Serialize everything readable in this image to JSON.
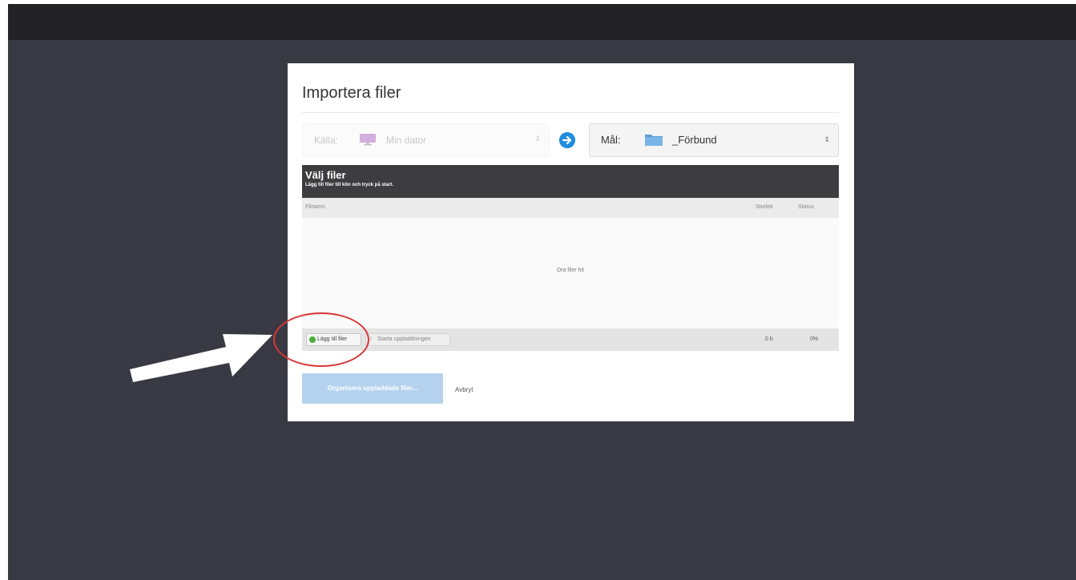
{
  "dialog": {
    "title": "Importera filer",
    "source": {
      "label": "Källa:",
      "value": "Min dator",
      "icon": "monitor-icon"
    },
    "target": {
      "label": "Mål:",
      "value": "_Förbund",
      "icon": "folder-icon"
    },
    "panel": {
      "heading": "Välj filer",
      "subheading": "Lägg till filer till kön och tryck på start."
    },
    "columns": {
      "filename": "Filnamn",
      "size": "Storlek",
      "status": "Status"
    },
    "drop_hint": "Dra filer hit",
    "buttons": {
      "add_files": "Lägg till filer",
      "start_upload": "Starta uppladdningen",
      "organize": "Organisera uppladdade filer...",
      "cancel": "Avbryt"
    },
    "totals": {
      "size": "0 b",
      "percent": "0%"
    }
  },
  "colors": {
    "background": "#393943",
    "topbar": "#232326",
    "accent": "#1f8ee0",
    "annotation": "#d93636"
  }
}
